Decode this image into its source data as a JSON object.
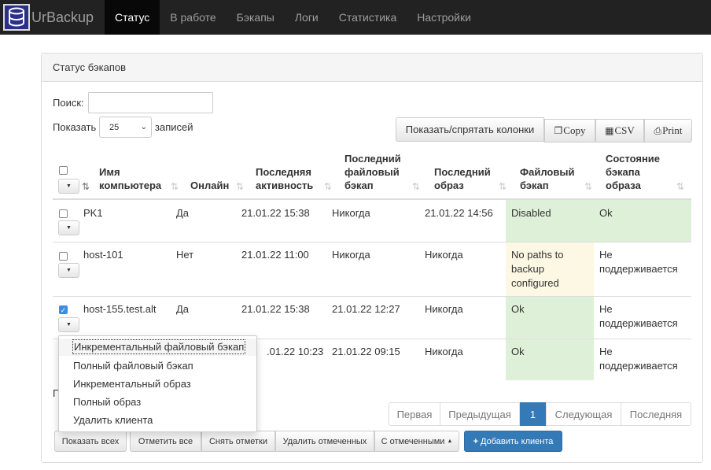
{
  "app": {
    "brand": "UrBackup"
  },
  "nav": {
    "status": "Статус",
    "in_progress": "В работе",
    "backups": "Бэкапы",
    "logs": "Логи",
    "statistics": "Статистика",
    "settings": "Настройки"
  },
  "panel": {
    "title": "Статус бэкапов"
  },
  "search": {
    "label": "Поиск:",
    "value": ""
  },
  "length": {
    "label_before": "Показать",
    "value": "25",
    "label_after": "записей"
  },
  "buttons": {
    "colvis": "Показать/спрятать колонки",
    "copy": "Copy",
    "csv": "CSV",
    "print": "Print"
  },
  "columns": {
    "name": [
      "Имя",
      "компьютера"
    ],
    "online": [
      "Онлайн"
    ],
    "last_seen": [
      "Последняя",
      "активность"
    ],
    "last_file": [
      "Последний",
      "файловый",
      "бэкап"
    ],
    "last_image": [
      "Последний",
      "образ"
    ],
    "file_status": [
      "Файловый",
      "бэкап"
    ],
    "image_status": [
      "Состояние",
      "бэкапа",
      "образа"
    ]
  },
  "rows": [
    {
      "name": "PK1",
      "online": "Да",
      "last_seen": "21.01.22 15:38",
      "last_file": "Никогда",
      "last_image": "21.01.22 14:56",
      "file_status": [
        "Disabled"
      ],
      "image_status": [
        "Ok"
      ],
      "checked": false
    },
    {
      "name": "host-101",
      "online": "Нет",
      "last_seen": "21.01.22 11:00",
      "last_file": "Никогда",
      "last_image": "Никогда",
      "file_status": [
        "No paths to",
        "backup",
        "configured"
      ],
      "image_status": [
        "Не",
        "поддерживается"
      ],
      "checked": false
    },
    {
      "name": "host-155.test.alt",
      "online": "Да",
      "last_seen": "21.01.22 15:38",
      "last_file": "21.01.22 12:27",
      "last_image": "Никогда",
      "file_status": [
        "Ok"
      ],
      "image_status": [
        "Не",
        "поддерживается"
      ],
      "checked": true
    },
    {
      "name": "",
      "online": "",
      "last_seen": ".01.22 10:23",
      "last_file": "21.01.22 09:15",
      "last_image": "Никогда",
      "file_status": [
        "Ok"
      ],
      "image_status": [
        "Не",
        "поддерживается"
      ],
      "checked": false
    }
  ],
  "context_menu": [
    "Инкрементальный файловый бэкап",
    "Полный файловый бэкап",
    "Инкрементальный образ",
    "Полный образ",
    "Удалить клиента"
  ],
  "info_fragment": "П",
  "pagination": {
    "first": "Первая",
    "prev": "Предыдущая",
    "current": "1",
    "next": "Следующая",
    "last": "Последняя"
  },
  "toolbar": {
    "show_all": "Показать всех",
    "select_all": "Отметить все",
    "deselect": "Снять отметки",
    "delete_selected": "Удалить отмеченных",
    "with_selected": "С отмеченными",
    "add_client": "Добавить клиента"
  },
  "colors": {
    "navbar": "#222222",
    "success": "#dff0d8",
    "warning": "#fcf8e3",
    "primary": "#337ab7"
  },
  "icons": {
    "brand": "database-icon",
    "sort": "sort-icon",
    "caret": "caret-down-icon",
    "plus": "plus-icon"
  }
}
